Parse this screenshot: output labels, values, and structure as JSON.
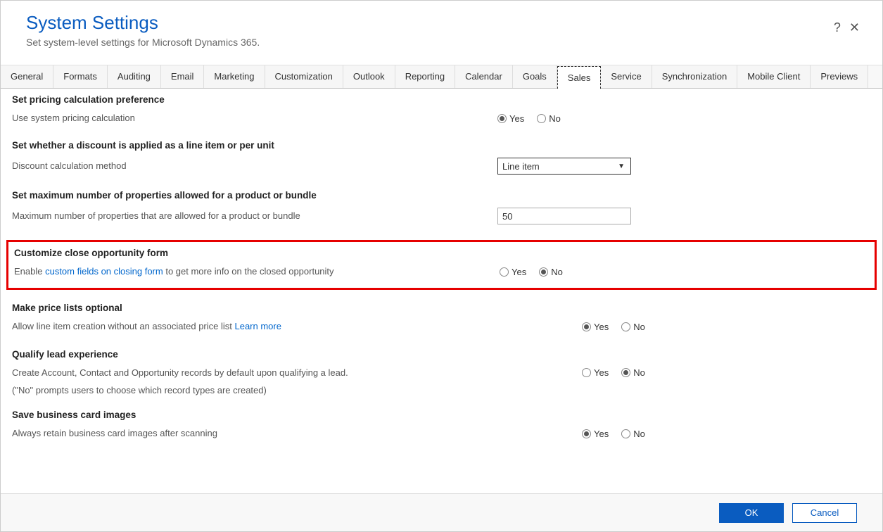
{
  "header": {
    "title": "System Settings",
    "subtitle": "Set system-level settings for Microsoft Dynamics 365.",
    "help_icon": "?",
    "close_icon": "✕"
  },
  "tabs": {
    "items": [
      "General",
      "Formats",
      "Auditing",
      "Email",
      "Marketing",
      "Customization",
      "Outlook",
      "Reporting",
      "Calendar",
      "Goals",
      "Sales",
      "Service",
      "Synchronization",
      "Mobile Client",
      "Previews"
    ],
    "active": "Sales"
  },
  "sections": {
    "pricing": {
      "title": "Set pricing calculation preference",
      "label": "Use system pricing calculation",
      "yes": "Yes",
      "no": "No",
      "selected": "Yes"
    },
    "discount": {
      "title": "Set whether a discount is applied as a line item or per unit",
      "label": "Discount calculation method",
      "select_value": "Line item"
    },
    "maxprops": {
      "title": "Set maximum number of properties allowed for a product or bundle",
      "label": "Maximum number of properties that are allowed for a product or bundle",
      "value": "50"
    },
    "closeopp": {
      "title": "Customize close opportunity form",
      "label_pre": "Enable ",
      "link": "custom fields on closing form",
      "label_post": " to get more info on the closed opportunity",
      "yes": "Yes",
      "no": "No",
      "selected": "No"
    },
    "pricelists": {
      "title": "Make price lists optional",
      "label_pre": "Allow line item creation without an associated price list ",
      "link": "Learn more",
      "yes": "Yes",
      "no": "No",
      "selected": "Yes"
    },
    "qualifylead": {
      "title": "Qualify lead experience",
      "label": "Create Account, Contact and Opportunity records by default upon qualifying a lead.",
      "sublabel": "(\"No\" prompts users to choose which record types are created)",
      "yes": "Yes",
      "no": "No",
      "selected": "No"
    },
    "bizcard": {
      "title": "Save business card images",
      "label": "Always retain business card images after scanning",
      "yes": "Yes",
      "no": "No",
      "selected": "Yes"
    }
  },
  "footer": {
    "ok": "OK",
    "cancel": "Cancel"
  }
}
